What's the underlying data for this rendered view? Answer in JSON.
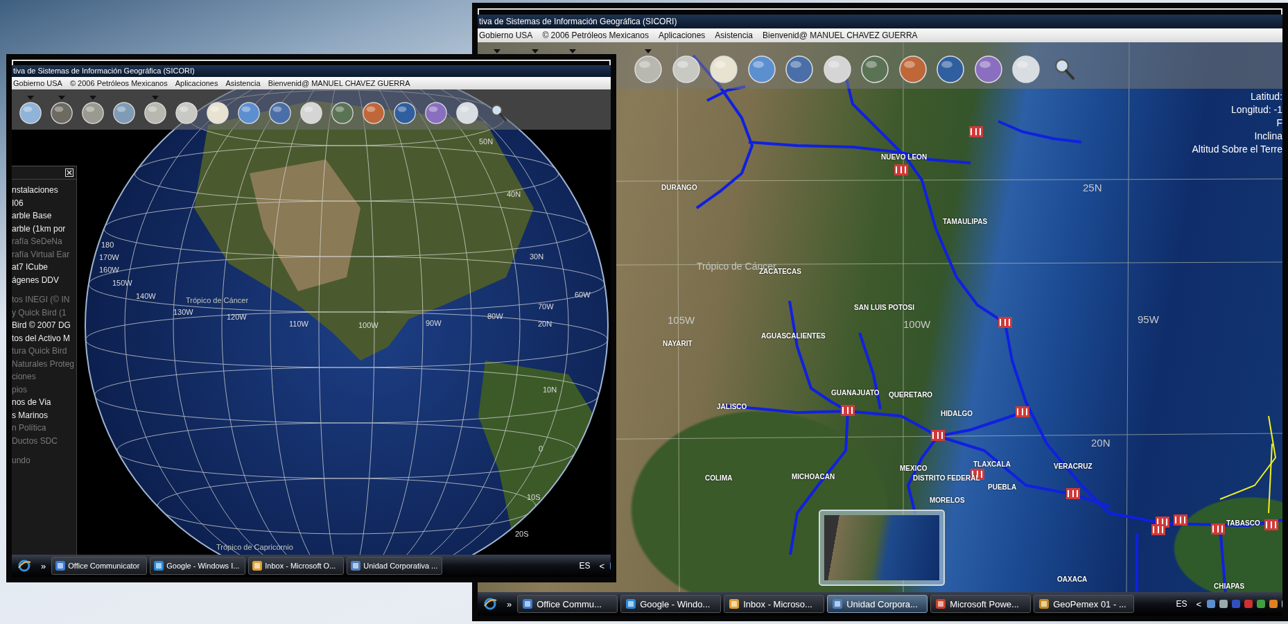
{
  "background_window": {
    "title": "tiva de Sistemas de Información Geográfica (SICORI)",
    "menu": [
      "Gobierno USA",
      "© 2006 Petróleos Mexicanos",
      "Aplicaciones",
      "Asistencia",
      "Bienvenid@ MANUEL CHAVEZ GUERRA"
    ],
    "tools": [
      {
        "kind": "covered",
        "has_menu": true
      },
      {
        "kind": "covered",
        "has_menu": true
      },
      {
        "kind": "covered",
        "has_menu": true
      },
      {
        "kind": "covered"
      },
      {
        "kind": "sphere",
        "has_menu": true
      },
      {
        "kind": "sphere",
        "has_menu": false
      },
      {
        "kind": "sphere",
        "has_menu": false
      },
      {
        "kind": "sphere",
        "has_menu": false
      },
      {
        "kind": "sphere",
        "has_menu": false
      },
      {
        "kind": "sphere",
        "has_menu": false
      },
      {
        "kind": "sphere",
        "has_menu": false
      },
      {
        "kind": "sphere",
        "has_menu": false
      },
      {
        "kind": "sphere",
        "has_menu": false
      },
      {
        "kind": "sphere",
        "has_menu": false
      },
      {
        "kind": "sphere",
        "has_menu": false
      },
      {
        "kind": "search",
        "has_menu": false
      }
    ],
    "readouts": [
      "Latitud:",
      "Longitud: -1",
      "F",
      "Inclina",
      "Altitud Sobre el Terre"
    ],
    "map_labels": [
      {
        "text": "DURANGO",
        "kind": "region"
      },
      {
        "text": "NUEVO LEON",
        "kind": "region"
      },
      {
        "text": "25N",
        "kind": "grid"
      },
      {
        "text": "TAMAULIPAS",
        "kind": "region"
      },
      {
        "text": "Trópico de Cáncer",
        "kind": "tropic"
      },
      {
        "text": "ZACATECAS",
        "kind": "region"
      },
      {
        "text": "SAN LUIS POTOSI",
        "kind": "region"
      },
      {
        "text": "105W",
        "kind": "grid"
      },
      {
        "text": "100W",
        "kind": "grid"
      },
      {
        "text": "95W",
        "kind": "grid"
      },
      {
        "text": "AGUASCALIENTES",
        "kind": "region"
      },
      {
        "text": "NAYARIT",
        "kind": "region"
      },
      {
        "text": "GUANAJUATO",
        "kind": "region"
      },
      {
        "text": "QUERETARO",
        "kind": "region"
      },
      {
        "text": "JALISCO",
        "kind": "region"
      },
      {
        "text": "HIDALGO",
        "kind": "region"
      },
      {
        "text": "20N",
        "kind": "grid"
      },
      {
        "text": "MEXICO",
        "kind": "region"
      },
      {
        "text": "TLAXCALA",
        "kind": "region"
      },
      {
        "text": "VERACRUZ",
        "kind": "region"
      },
      {
        "text": "COLIMA",
        "kind": "region"
      },
      {
        "text": "MICHOACAN",
        "kind": "region"
      },
      {
        "text": "DISTRITO FEDERAL",
        "kind": "region"
      },
      {
        "text": "PUEBLA",
        "kind": "region"
      },
      {
        "text": "MORELOS",
        "kind": "region"
      },
      {
        "text": "TABASCO",
        "kind": "region"
      },
      {
        "text": "OAXACA",
        "kind": "region"
      },
      {
        "text": "CHIAPAS",
        "kind": "region"
      }
    ],
    "taskbar": {
      "quick_launch": "»",
      "tasks": [
        {
          "label": "Office Commu...",
          "selected": false,
          "preview": false
        },
        {
          "label": "Google - Windo...",
          "selected": false,
          "preview": false
        },
        {
          "label": "Inbox - Microso...",
          "selected": false,
          "preview": false
        },
        {
          "label": "Unidad Corpora...",
          "selected": true,
          "preview": true
        },
        {
          "label": "Microsoft Powe...",
          "selected": false,
          "preview": false
        },
        {
          "label": "GeoPemex 01 - ...",
          "selected": false,
          "preview": false
        }
      ],
      "language": "ES",
      "tray_toggle": "<"
    }
  },
  "foreground_window": {
    "title": "tiva de Sistemas de Información Geográfica (SICORI)",
    "menu": [
      "Gobierno USA",
      "© 2006 Petróleos Mexicanos",
      "Aplicaciones",
      "Asistencia",
      "Bienvenid@ MANUEL CHAVEZ GUERRA"
    ],
    "tools": [
      {
        "kind": "sphere",
        "has_menu": true
      },
      {
        "kind": "sphere",
        "has_menu": true
      },
      {
        "kind": "sphere",
        "has_menu": true
      },
      {
        "kind": "sphere",
        "has_menu": false
      },
      {
        "kind": "sphere",
        "has_menu": true
      },
      {
        "kind": "sphere",
        "has_menu": false
      },
      {
        "kind": "sphere",
        "has_menu": false
      },
      {
        "kind": "sphere",
        "has_menu": false
      },
      {
        "kind": "sphere",
        "has_menu": false
      },
      {
        "kind": "sphere",
        "has_menu": false
      },
      {
        "kind": "sphere",
        "has_menu": false
      },
      {
        "kind": "sphere",
        "has_menu": false
      },
      {
        "kind": "sphere",
        "has_menu": false
      },
      {
        "kind": "sphere",
        "has_menu": false
      },
      {
        "kind": "sphere",
        "has_menu": false
      },
      {
        "kind": "search",
        "has_menu": false
      }
    ],
    "layer_panel": {
      "groups": [
        [
          {
            "label": "nstalaciones",
            "enabled": true
          },
          {
            "label": "I06",
            "enabled": true
          },
          {
            "label": "arble Base",
            "enabled": true
          },
          {
            "label": "arble (1km por",
            "enabled": true
          },
          {
            "label": "rafía SeDeNa",
            "enabled": false
          },
          {
            "label": "rafía Virtual Ear",
            "enabled": false
          },
          {
            "label": "at7 ICube",
            "enabled": true
          },
          {
            "label": "ágenes DDV",
            "enabled": true
          }
        ],
        [
          {
            "label": "tos INEGI (© IN",
            "enabled": false
          },
          {
            "label": "y Quick Bird (1",
            "enabled": false
          },
          {
            "label": "Bird © 2007 DG",
            "enabled": true
          },
          {
            "label": "tos del Activo M",
            "enabled": true
          },
          {
            "label": "tura Quick Bird",
            "enabled": false
          },
          {
            "label": "Naturales Proteg",
            "enabled": false
          },
          {
            "label": "ciones",
            "enabled": false
          },
          {
            "label": "pios",
            "enabled": false
          },
          {
            "label": "nos de Via",
            "enabled": true
          },
          {
            "label": "s Marinos",
            "enabled": true
          },
          {
            "label": "n Política",
            "enabled": false
          },
          {
            "label": "Ductos SDC",
            "enabled": false
          }
        ],
        [
          {
            "label": "undo",
            "enabled": false
          }
        ]
      ]
    },
    "globe_labels": [
      {
        "text": "50N",
        "kind": "grid"
      },
      {
        "text": "40N",
        "kind": "grid"
      },
      {
        "text": "30N",
        "kind": "grid"
      },
      {
        "text": "180",
        "kind": "grid"
      },
      {
        "text": "170W",
        "kind": "grid"
      },
      {
        "text": "160W",
        "kind": "grid"
      },
      {
        "text": "150W",
        "kind": "grid"
      },
      {
        "text": "140W",
        "kind": "grid"
      },
      {
        "text": "Trópico de Cáncer",
        "kind": "tropic"
      },
      {
        "text": "130W",
        "kind": "grid"
      },
      {
        "text": "120W",
        "kind": "grid"
      },
      {
        "text": "110W",
        "kind": "grid"
      },
      {
        "text": "100W",
        "kind": "grid"
      },
      {
        "text": "90W",
        "kind": "grid"
      },
      {
        "text": "80W",
        "kind": "grid"
      },
      {
        "text": "70W",
        "kind": "grid"
      },
      {
        "text": "60W",
        "kind": "grid"
      },
      {
        "text": "20N",
        "kind": "grid"
      },
      {
        "text": "10N",
        "kind": "grid"
      },
      {
        "text": "0",
        "kind": "grid"
      },
      {
        "text": "10S",
        "kind": "grid"
      },
      {
        "text": "20S",
        "kind": "grid"
      },
      {
        "text": "Trópico de Capricornio",
        "kind": "tropic"
      }
    ],
    "taskbar": {
      "quick_launch": "»",
      "tasks": [
        {
          "label": "Office Communicator",
          "selected": false
        },
        {
          "label": "Google - Windows I...",
          "selected": false
        },
        {
          "label": "Inbox - Microsoft O...",
          "selected": false
        },
        {
          "label": "Unidad Corporativa ...",
          "selected": false
        }
      ],
      "language": "ES",
      "tray_toggle": "<"
    }
  }
}
